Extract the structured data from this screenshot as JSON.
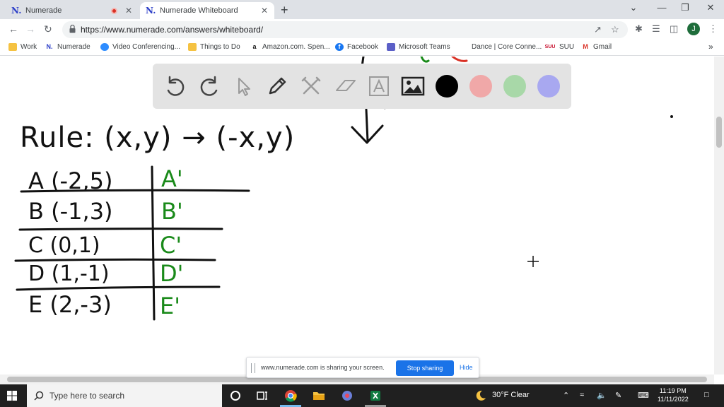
{
  "tabs": [
    {
      "favicon": "N.",
      "title": "Numerade",
      "recording": true,
      "close": "✕"
    },
    {
      "favicon": "N.",
      "title": "Numerade Whiteboard",
      "close": "✕"
    }
  ],
  "new_tab": "+",
  "window_controls": {
    "chevron": "⌄",
    "minimize": "—",
    "restore": "❐",
    "close": "✕"
  },
  "address_bar": {
    "url": "https://www.numerade.com/answers/whiteboard/"
  },
  "profile_initial": "J",
  "bookmarks": [
    {
      "label": "Work",
      "icon": "folder-icon"
    },
    {
      "label": "Numerade",
      "icon": "N."
    },
    {
      "label": "Video Conferencing...",
      "icon": "video-icon"
    },
    {
      "label": "Things to Do",
      "icon": "folder-icon"
    },
    {
      "label": "Amazon.com. Spen...",
      "icon": "a"
    },
    {
      "label": "Facebook",
      "icon": "f"
    },
    {
      "label": "Microsoft Teams",
      "icon": "teams-icon"
    },
    {
      "label": "Dance | Core Conne...",
      "icon": "globe-icon"
    },
    {
      "label": "SUU",
      "icon": "SUU"
    },
    {
      "label": "Gmail",
      "icon": "M"
    }
  ],
  "bookmarks_overflow": "»",
  "whiteboard": {
    "tools": [
      "undo-icon",
      "redo-icon",
      "pointer-icon",
      "pen-icon",
      "tools-icon",
      "eraser-icon",
      "text-icon",
      "image-icon"
    ],
    "colors": [
      "#000000",
      "#f0a8a8",
      "#a8d8a8",
      "#a8a8f0"
    ],
    "rule": "Rule: (x,y) → (-x,y)",
    "table": [
      {
        "point": "A (-2,5)",
        "image": "A'"
      },
      {
        "point": "B (-1,3)",
        "image": "B'"
      },
      {
        "point": "C (0,1)",
        "image": "C'"
      },
      {
        "point": "D (1,-1)",
        "image": "D'"
      },
      {
        "point": "E (2,-3)",
        "image": "E'"
      }
    ],
    "arrow": "↓"
  },
  "share_bar": {
    "message": "www.numerade.com is sharing your screen.",
    "stop_label": "Stop sharing",
    "hide_label": "Hide"
  },
  "taskbar": {
    "search_placeholder": "Type here to search",
    "weather": "30°F  Clear",
    "time": "11:19 PM",
    "date": "11/11/2022"
  }
}
